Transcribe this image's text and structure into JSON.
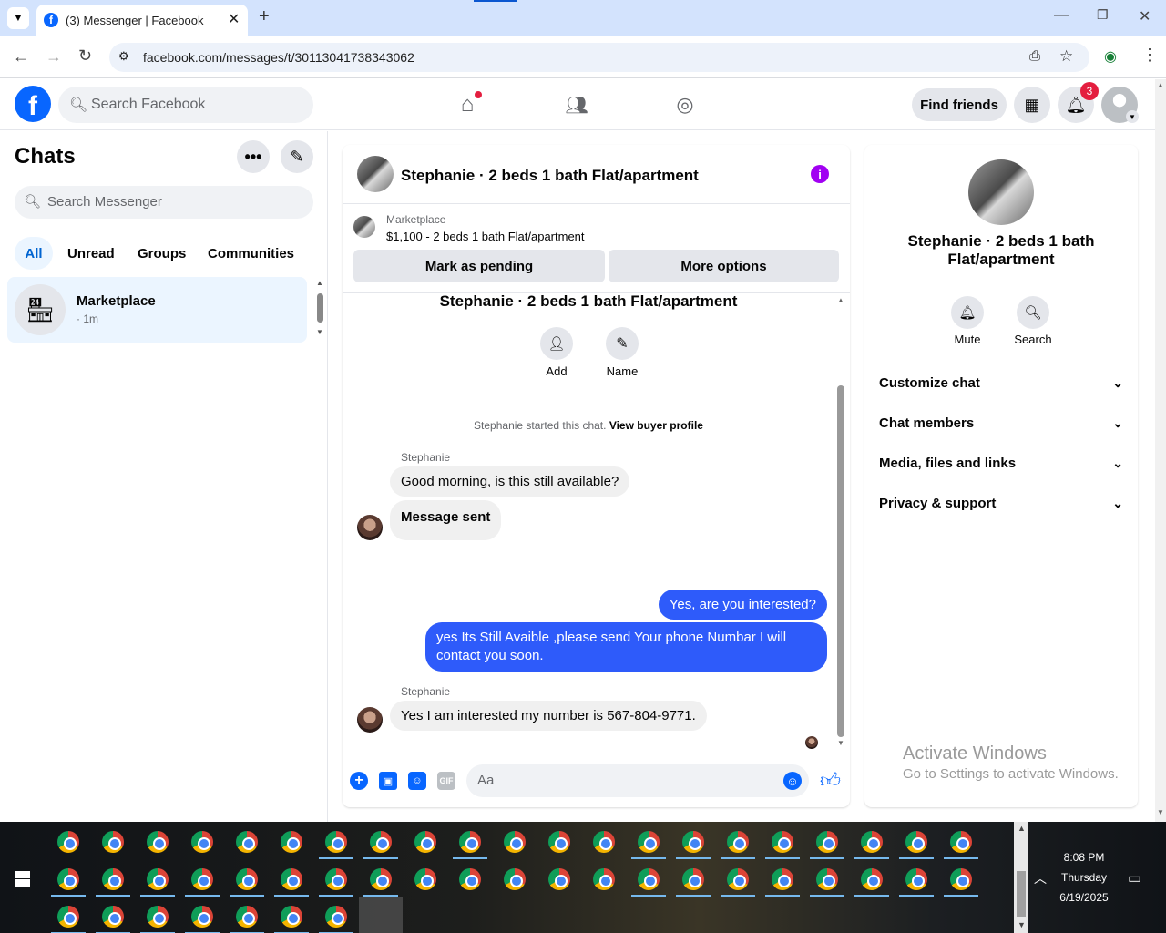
{
  "browser": {
    "tab_title": "(3) Messenger | Facebook",
    "url": "facebook.com/messages/t/30113041738343062"
  },
  "fb": {
    "search_placeholder": "Search Facebook",
    "find_friends": "Find friends",
    "notif_count": "3"
  },
  "left": {
    "title": "Chats",
    "search_placeholder": "Search Messenger",
    "filters": [
      "All",
      "Unread",
      "Groups",
      "Communities"
    ],
    "chats": [
      {
        "name": "Marketplace",
        "meta": "· 1m"
      }
    ]
  },
  "chat": {
    "title": "Stephanie · 2 beds 1 bath Flat/apartment",
    "listing_source": "Marketplace",
    "listing_detail": "$1,100 - 2 beds 1 bath Flat/apartment",
    "mark_pending": "Mark as pending",
    "more_options": "More options",
    "intro_title": "Stephanie · 2 beds 1 bath Flat/apartment",
    "add_label": "Add",
    "name_label": "Name",
    "started_text": "Stephanie started this chat.",
    "view_profile": "View buyer profile",
    "messages": [
      {
        "sender": "Stephanie",
        "text": "Good morning, is this still available?"
      },
      {
        "text": "Message sent"
      },
      {
        "text": "Yes, are you interested?"
      },
      {
        "text": "yes Its Still Avaible ,please send Your phone Numbar I will contact you soon."
      },
      {
        "sender": "Stephanie",
        "text": "Yes I am interested my number is 567-804-9771."
      }
    ],
    "composer_placeholder": "Aa"
  },
  "info": {
    "name": "Stephanie · 2 beds 1 bath Flat/apartment",
    "mute": "Mute",
    "search": "Search",
    "sections": [
      "Customize chat",
      "Chat members",
      "Media, files and links",
      "Privacy & support"
    ]
  },
  "watermark": {
    "line1": "Activate Windows",
    "line2": "Go to Settings to activate Windows."
  },
  "clock": {
    "time": "8:08 PM",
    "day": "Thursday",
    "date": "6/19/2025"
  },
  "colors": {
    "fb_blue": "#0866ff",
    "out_bubble": "#2e5bfa",
    "purple_info": "#a100f2"
  }
}
